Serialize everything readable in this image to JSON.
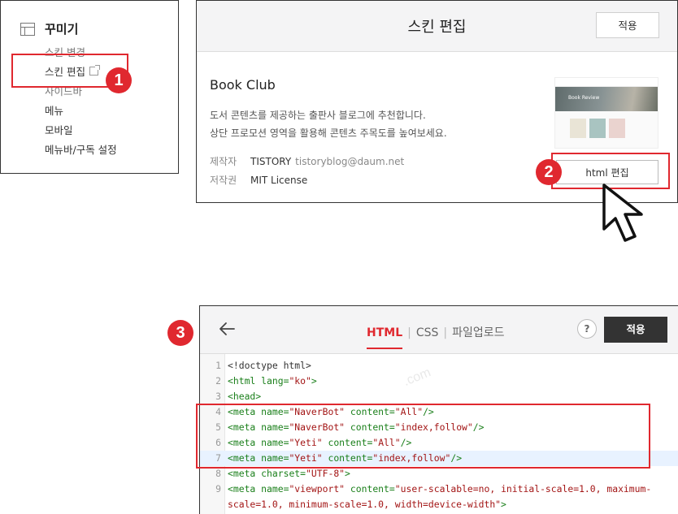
{
  "sidebar": {
    "header": {
      "icon": "layout-icon",
      "title": "꾸미기"
    },
    "items": [
      {
        "label": "스킨 변경"
      },
      {
        "label": "스킨 편집",
        "icon": "external-link-icon"
      },
      {
        "label": "사이드바"
      },
      {
        "label": "메뉴"
      },
      {
        "label": "모바일"
      },
      {
        "label": "메뉴바/구독 설정"
      }
    ]
  },
  "markers": {
    "one": "1",
    "two": "2",
    "three": "3"
  },
  "skin_panel": {
    "title": "스킨 편집",
    "apply_label": "적용",
    "skin_name": "Book Club",
    "description": [
      "도서 콘텐츠를 제공하는 출판사 블로그에 추천합니다.",
      "상단 프로모션 영역을 활용해 콘텐츠 주목도를 높여보세요."
    ],
    "author_key": "제작자",
    "author_name": "TISTORY",
    "author_email": "tistoryblog@daum.net",
    "license_key": "저작권",
    "license_value": "MIT License",
    "thumbnail_text": "Book Review",
    "html_edit_label": "html 편집"
  },
  "editor": {
    "back_icon": "back-arrow-icon",
    "tabs": [
      {
        "label": "HTML",
        "active": true
      },
      {
        "label": "CSS"
      },
      {
        "label": "파일업로드"
      }
    ],
    "help_label": "?",
    "apply_label": "적용",
    "watermark": ".com",
    "lines": [
      {
        "n": "1",
        "tokens": [
          {
            "t": "<!doctype html>",
            "c": "plain"
          }
        ]
      },
      {
        "n": "2",
        "tokens": [
          {
            "t": "<html ",
            "c": "tag"
          },
          {
            "t": "lang=",
            "c": "attr"
          },
          {
            "t": "\"ko\"",
            "c": "val"
          },
          {
            "t": ">",
            "c": "tag"
          }
        ]
      },
      {
        "n": "3",
        "tokens": [
          {
            "t": "<head>",
            "c": "tag"
          }
        ]
      },
      {
        "n": "4",
        "tokens": [
          {
            "t": "<meta ",
            "c": "tag"
          },
          {
            "t": "name=",
            "c": "attr"
          },
          {
            "t": "\"NaverBot\"",
            "c": "val"
          },
          {
            "t": " content=",
            "c": "attr"
          },
          {
            "t": "\"All\"",
            "c": "val"
          },
          {
            "t": "/>",
            "c": "tag"
          }
        ]
      },
      {
        "n": "5",
        "tokens": [
          {
            "t": "<meta ",
            "c": "tag"
          },
          {
            "t": "name=",
            "c": "attr"
          },
          {
            "t": "\"NaverBot\"",
            "c": "val"
          },
          {
            "t": " content=",
            "c": "attr"
          },
          {
            "t": "\"index,follow\"",
            "c": "val"
          },
          {
            "t": "/>",
            "c": "tag"
          }
        ]
      },
      {
        "n": "6",
        "tokens": [
          {
            "t": "<meta ",
            "c": "tag"
          },
          {
            "t": "name=",
            "c": "attr"
          },
          {
            "t": "\"Yeti\"",
            "c": "val"
          },
          {
            "t": " content=",
            "c": "attr"
          },
          {
            "t": "\"All\"",
            "c": "val"
          },
          {
            "t": "/>",
            "c": "tag"
          }
        ]
      },
      {
        "n": "7",
        "hl": true,
        "tokens": [
          {
            "t": "<meta ",
            "c": "tag"
          },
          {
            "t": "name=",
            "c": "attr"
          },
          {
            "t": "\"Yeti\"",
            "c": "val"
          },
          {
            "t": " content=",
            "c": "attr"
          },
          {
            "t": "\"index,follow\"",
            "c": "val"
          },
          {
            "t": "/>",
            "c": "tag"
          }
        ]
      },
      {
        "n": "8",
        "tokens": [
          {
            "t": "<meta ",
            "c": "tag"
          },
          {
            "t": "charset=",
            "c": "attr"
          },
          {
            "t": "\"UTF-8\"",
            "c": "val"
          },
          {
            "t": ">",
            "c": "tag"
          }
        ]
      },
      {
        "n": "9",
        "tokens": [
          {
            "t": "<meta ",
            "c": "tag"
          },
          {
            "t": "name=",
            "c": "attr"
          },
          {
            "t": "\"viewport\"",
            "c": "val"
          },
          {
            "t": " content=",
            "c": "attr"
          },
          {
            "t": "\"user-scalable=no, initial-scale=1.0, maximum-",
            "c": "val"
          }
        ]
      },
      {
        "n": "",
        "tokens": [
          {
            "t": "scale=1.0, minimum-scale=1.0, width=device-width\"",
            "c": "val"
          },
          {
            "t": ">",
            "c": "tag"
          }
        ]
      }
    ]
  },
  "colors": {
    "highlight_red": "#e0282f",
    "apply_dark": "#333333",
    "tag_green": "#1a7f1a",
    "value_red": "#a31515"
  }
}
